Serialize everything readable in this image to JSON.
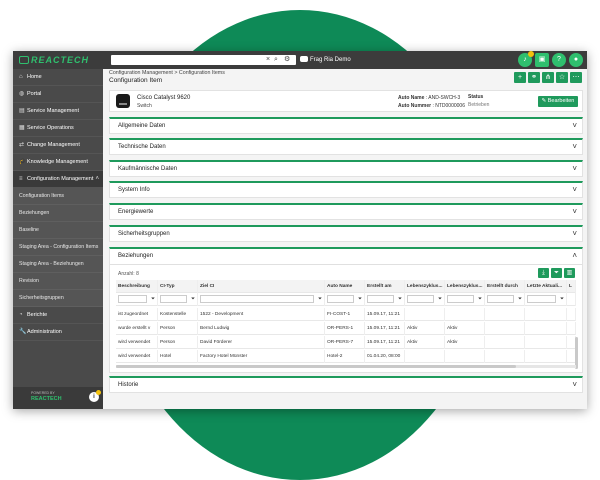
{
  "brand": {
    "logo_text": "REACTECH",
    "powered_by": "POWERED BY",
    "powered_logo": "REACTECH"
  },
  "topbar": {
    "search_placeholder": "",
    "clear_icon": "×",
    "search_icon": "⌕",
    "settings_icon": "⚙",
    "user_label": "Frag Ria Demo"
  },
  "sidebar": {
    "items": [
      {
        "label": "Home",
        "icon": "⌂"
      },
      {
        "label": "Portal",
        "icon": "◍"
      },
      {
        "label": "Service Management",
        "icon": "▤"
      },
      {
        "label": "Service Operations",
        "icon": "▦"
      },
      {
        "label": "Change Management",
        "icon": "⇄"
      },
      {
        "label": "Knowledge Management",
        "icon": "🎓"
      },
      {
        "label": "Configuration Management",
        "icon": "≡"
      }
    ],
    "subitems": [
      "Configuration Items",
      "Beziehungen",
      "Baseline",
      "Staging Area - Configuration Items",
      "Staging Area - Beziehungen",
      "Revision",
      "Sicherheitsgruppen"
    ],
    "bottom_items": [
      {
        "label": "Berichte",
        "icon": "◔"
      },
      {
        "label": "Administration",
        "icon": "🔧"
      }
    ]
  },
  "main": {
    "breadcrumb": "Configuration Management > Configuration Items",
    "title": "Configuration Item",
    "ci": {
      "name": "Cisco Catalyst 9620",
      "type": "Switch",
      "auto_name_label": "Auto Name",
      "auto_name_value": ": AND-SWCH-3",
      "auto_number_label": "Auto Nummer",
      "auto_number_value": ": NTD0000006",
      "status_label": "Status",
      "status_value": "Betrieben",
      "edit_label": "Bearbeiten"
    },
    "panels": [
      "Allgemeine Daten",
      "Technische Daten",
      "Kaufmännische Daten",
      "System Info",
      "Energiewerte",
      "Sicherheitsgruppen"
    ],
    "relations": {
      "title": "Beziehungen",
      "count": "Anzahl: 8",
      "columns": [
        "Beschreibung",
        "CI-Typ",
        "Ziel CI",
        "Auto Name",
        "Erstellt am",
        "Lebenszyklus...",
        "Lebenszyklus...",
        "Erstellt durch",
        "Letzte Aktuali...",
        "L"
      ],
      "rows": [
        [
          "ist zugeordnet",
          "Kostenstelle",
          "1522 - Development",
          "FI-COST-1",
          "15.09.17, 11:21",
          "",
          "",
          "",
          "",
          ""
        ],
        [
          "wurde erstellt v",
          "Person",
          "Bernd Ludwig",
          "OR-PERS-1",
          "15.09.17, 11:21",
          "Aktiv",
          "Aktiv",
          "",
          "",
          ""
        ],
        [
          "wird verwendet",
          "Person",
          "David Förderer",
          "OR-PERS-7",
          "15.09.17, 11:21",
          "Aktiv",
          "Aktiv",
          "",
          "",
          ""
        ],
        [
          "wird verwendet",
          "Hotel",
          "Factory Hotel Münster",
          "Hotel-2",
          "01.04.20, 08:00",
          "",
          "",
          "",
          "",
          ""
        ]
      ]
    },
    "history_title": "Historie"
  },
  "colors": {
    "brand_green": "#1f9a5c",
    "sidebar_bg": "#4a4a4a",
    "topbar_bg": "#3c3c3c",
    "circle": "#0e8a57"
  }
}
